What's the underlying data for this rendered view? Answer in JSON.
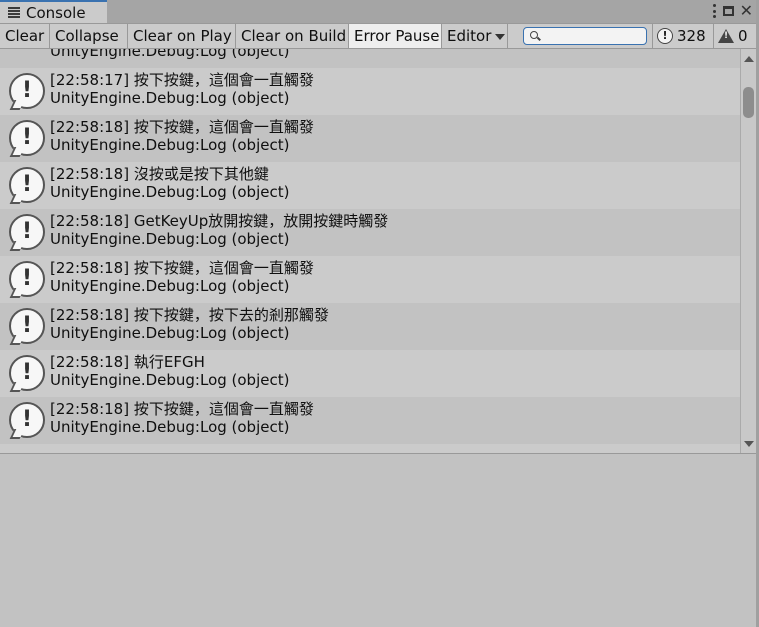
{
  "tab": {
    "title": "Console"
  },
  "toolbar": {
    "clear": "Clear",
    "collapse": "Collapse",
    "clear_on_play": "Clear on Play",
    "clear_on_build": "Clear on Build",
    "error_pause": "Error Pause",
    "editor": "Editor",
    "search_placeholder": "",
    "info_count": "328",
    "warning_count": "0"
  },
  "logs": {
    "top_partial": {
      "line2": "UnityEngine.Debug:Log (object)"
    },
    "entries": [
      {
        "line1": "[22:58:17] 按下按鍵，這個會一直觸發",
        "line2": "UnityEngine.Debug:Log (object)"
      },
      {
        "line1": "[22:58:18] 按下按鍵，這個會一直觸發",
        "line2": "UnityEngine.Debug:Log (object)"
      },
      {
        "line1": "[22:58:18] 沒按或是按下其他鍵",
        "line2": "UnityEngine.Debug:Log (object)"
      },
      {
        "line1": "[22:58:18] GetKeyUp放開按鍵，放開按鍵時觸發",
        "line2": "UnityEngine.Debug:Log (object)"
      },
      {
        "line1": "[22:58:18] 按下按鍵，這個會一直觸發",
        "line2": "UnityEngine.Debug:Log (object)"
      },
      {
        "line1": "[22:58:18] 按下按鍵，按下去的剎那觸發",
        "line2": "UnityEngine.Debug:Log (object)"
      },
      {
        "line1": "[22:58:18] 執行EFGH",
        "line2": "UnityEngine.Debug:Log (object)"
      },
      {
        "line1": "[22:58:18] 按下按鍵，這個會一直觸發",
        "line2": "UnityEngine.Debug:Log (object)"
      }
    ]
  },
  "icons": {
    "tab": "console-icon",
    "menu": "kebab-menu-icon",
    "maximize": "maximize-icon",
    "close": "close-icon",
    "search": "search-icon",
    "info": "info-icon",
    "warning": "warning-icon"
  }
}
